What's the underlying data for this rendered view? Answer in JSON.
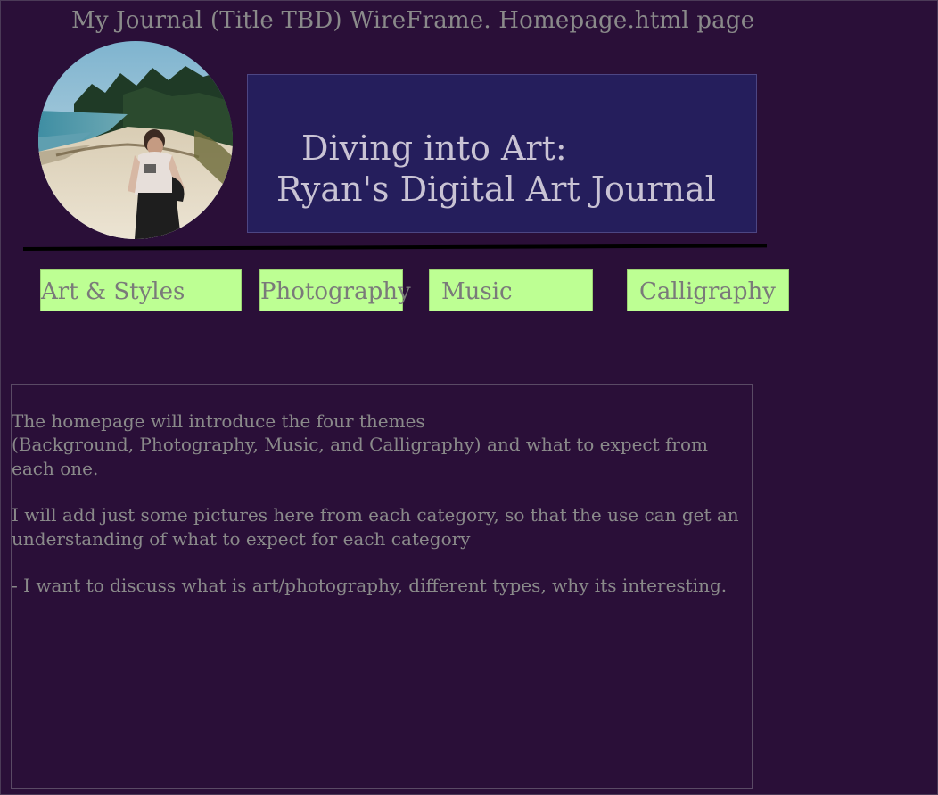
{
  "page": {
    "wireframe_title": "My Journal (Title TBD) WireFrame.  Homepage.html page"
  },
  "header": {
    "avatar_icon": "profile-photo-beach",
    "banner_line1": "Diving into Art:",
    "banner_line2": "Ryan's Digital Art Journal"
  },
  "nav": {
    "items": [
      {
        "label": "Art & Styles"
      },
      {
        "label": "Photography"
      },
      {
        "label": "Music"
      },
      {
        "label": "Calligraphy"
      }
    ]
  },
  "content": {
    "lines": [
      "The homepage will introduce the four themes",
      "(Background, Photography, Music, and Calligraphy) and what to expect from",
      "each one.",
      "I will add just some pictures here from each category, so that the use can get an",
      "understanding of what to expect for each category",
      "- I want to discuss what is art/photography, different types, why its interesting."
    ]
  },
  "colors": {
    "background": "#2a0f38",
    "banner": "#251e5c",
    "nav_button": "#bdff93",
    "text_muted": "#8a8a8a",
    "banner_text": "#c9c3d4"
  }
}
